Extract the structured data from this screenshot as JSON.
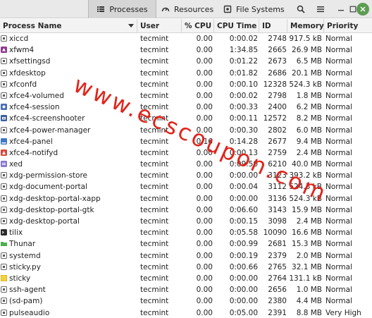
{
  "tabs": [
    {
      "label": "Processes",
      "icon": "list-icon"
    },
    {
      "label": "Resources",
      "icon": "gauge-icon"
    },
    {
      "label": "File Systems",
      "icon": "disk-icon"
    }
  ],
  "columns": {
    "name": "Process Name",
    "user": "User",
    "cpu": "% CPU",
    "cpu_time": "CPU Time",
    "id": "ID",
    "memory": "Memory",
    "priority": "Priority"
  },
  "processes": [
    {
      "name": "xiccd",
      "user": "tecmint",
      "cpu": "0.00",
      "time": "0:00.02",
      "id": "2748",
      "mem": "917.5 kB",
      "pri": "Normal",
      "icon": "generic-process-icon"
    },
    {
      "name": "xfwm4",
      "user": "tecmint",
      "cpu": "0.00",
      "time": "1:34.85",
      "id": "2665",
      "mem": "26.9 MB",
      "pri": "Normal",
      "icon": "xfwm4-icon"
    },
    {
      "name": "xfsettingsd",
      "user": "tecmint",
      "cpu": "0.00",
      "time": "0:01.22",
      "id": "2673",
      "mem": "6.5 MB",
      "pri": "Normal",
      "icon": "generic-process-icon"
    },
    {
      "name": "xfdesktop",
      "user": "tecmint",
      "cpu": "0.00",
      "time": "0:01.82",
      "id": "2686",
      "mem": "20.1 MB",
      "pri": "Normal",
      "icon": "generic-process-icon"
    },
    {
      "name": "xfconfd",
      "user": "tecmint",
      "cpu": "0.00",
      "time": "0:00.10",
      "id": "12328",
      "mem": "524.3 kB",
      "pri": "Normal",
      "icon": "generic-process-icon"
    },
    {
      "name": "xfce4-volumed",
      "user": "tecmint",
      "cpu": "0.00",
      "time": "0:00.02",
      "id": "2798",
      "mem": "1.8 MB",
      "pri": "Normal",
      "icon": "generic-process-icon"
    },
    {
      "name": "xfce4-session",
      "user": "tecmint",
      "cpu": "0.00",
      "time": "0:00.33",
      "id": "2400",
      "mem": "6.2 MB",
      "pri": "Normal",
      "icon": "session-icon"
    },
    {
      "name": "xfce4-screenshooter",
      "user": "tecmint",
      "cpu": "0.00",
      "time": "0:00.11",
      "id": "12572",
      "mem": "8.2 MB",
      "pri": "Normal",
      "icon": "screenshooter-icon"
    },
    {
      "name": "xfce4-power-manager",
      "user": "tecmint",
      "cpu": "0.00",
      "time": "0:00.30",
      "id": "2802",
      "mem": "6.0 MB",
      "pri": "Normal",
      "icon": "generic-process-icon"
    },
    {
      "name": "xfce4-panel",
      "user": "tecmint",
      "cpu": "0.16",
      "time": "0:14.28",
      "id": "2677",
      "mem": "9.4 MB",
      "pri": "Normal",
      "icon": "panel-icon"
    },
    {
      "name": "xfce4-notifyd",
      "user": "tecmint",
      "cpu": "0.00",
      "time": "0:00.13",
      "id": "2759",
      "mem": "2.4 MB",
      "pri": "Normal",
      "icon": "notifyd-icon"
    },
    {
      "name": "xed",
      "user": "tecmint",
      "cpu": "0.00",
      "time": "0:09.50",
      "id": "6210",
      "mem": "40.0 MB",
      "pri": "Normal",
      "icon": "xed-icon"
    },
    {
      "name": "xdg-permission-store",
      "user": "tecmint",
      "cpu": "0.00",
      "time": "0:00.00",
      "id": "3123",
      "mem": "393.2 kB",
      "pri": "Normal",
      "icon": "generic-process-icon"
    },
    {
      "name": "xdg-document-portal",
      "user": "tecmint",
      "cpu": "0.00",
      "time": "0:00.04",
      "id": "3112",
      "mem": "524.3 kB",
      "pri": "Normal",
      "icon": "generic-process-icon"
    },
    {
      "name": "xdg-desktop-portal-xapp",
      "user": "tecmint",
      "cpu": "0.00",
      "time": "0:00.00",
      "id": "3136",
      "mem": "524.3 kB",
      "pri": "Normal",
      "icon": "generic-process-icon"
    },
    {
      "name": "xdg-desktop-portal-gtk",
      "user": "tecmint",
      "cpu": "0.00",
      "time": "0:06.60",
      "id": "3143",
      "mem": "15.9 MB",
      "pri": "Normal",
      "icon": "generic-process-icon"
    },
    {
      "name": "xdg-desktop-portal",
      "user": "tecmint",
      "cpu": "0.00",
      "time": "0:00.15",
      "id": "3098",
      "mem": "2.4 MB",
      "pri": "Normal",
      "icon": "generic-process-icon"
    },
    {
      "name": "tilix",
      "user": "tecmint",
      "cpu": "0.00",
      "time": "0:05.58",
      "id": "10090",
      "mem": "16.6 MB",
      "pri": "Normal",
      "icon": "terminal-icon"
    },
    {
      "name": "Thunar",
      "user": "tecmint",
      "cpu": "0.00",
      "time": "0:00.99",
      "id": "2681",
      "mem": "15.3 MB",
      "pri": "Normal",
      "icon": "folder-icon"
    },
    {
      "name": "systemd",
      "user": "tecmint",
      "cpu": "0.00",
      "time": "0:00.19",
      "id": "2379",
      "mem": "2.0 MB",
      "pri": "Normal",
      "icon": "generic-process-icon"
    },
    {
      "name": "sticky.py",
      "user": "tecmint",
      "cpu": "0.00",
      "time": "0:00.66",
      "id": "2765",
      "mem": "32.1 MB",
      "pri": "Normal",
      "icon": "generic-process-icon"
    },
    {
      "name": "sticky",
      "user": "tecmint",
      "cpu": "0.00",
      "time": "0:00.00",
      "id": "2764",
      "mem": "131.1 kB",
      "pri": "Normal",
      "icon": "sticky-note-icon"
    },
    {
      "name": "ssh-agent",
      "user": "tecmint",
      "cpu": "0.00",
      "time": "0:00.00",
      "id": "2656",
      "mem": "1.0 MB",
      "pri": "Normal",
      "icon": "generic-process-icon"
    },
    {
      "name": "(sd-pam)",
      "user": "tecmint",
      "cpu": "0.00",
      "time": "0:00.00",
      "id": "2380",
      "mem": "4.4 MB",
      "pri": "Normal",
      "icon": "generic-process-icon"
    },
    {
      "name": "pulseaudio",
      "user": "tecmint",
      "cpu": "0.00",
      "time": "0:05.00",
      "id": "2391",
      "mem": "8.8 MB",
      "pri": "Very High",
      "icon": "generic-process-icon"
    }
  ],
  "watermark": {
    "text": "www.ecscoupon.com",
    "color": "#e0241b"
  },
  "colors": {
    "header_bg": "#e9e9e9",
    "active_tab": "#d6d6d6",
    "close_button": "#5d9c52"
  }
}
